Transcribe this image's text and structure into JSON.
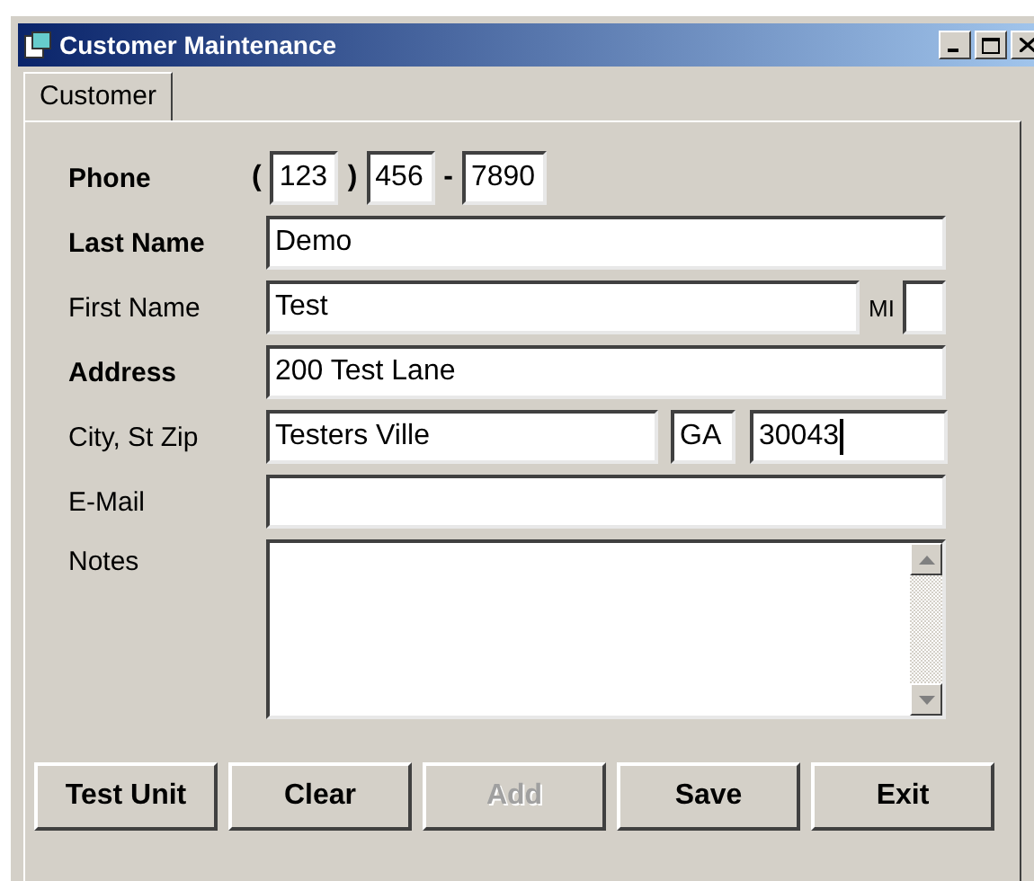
{
  "window": {
    "title": "Customer Maintenance"
  },
  "tabs": [
    {
      "label": "Customer",
      "selected": true
    }
  ],
  "rows": [
    {
      "kind": "phone",
      "label": "Phone",
      "bold": true,
      "segments": [
        {
          "kind": "sep",
          "text": "("
        },
        {
          "kind": "field",
          "value": "123"
        },
        {
          "kind": "sep",
          "text": ")"
        },
        {
          "kind": "field",
          "value": "456"
        },
        {
          "kind": "sep",
          "text": "-"
        },
        {
          "kind": "field",
          "value": "7890"
        }
      ]
    },
    {
      "kind": "text",
      "label": "Last Name",
      "bold": true,
      "value": "Demo"
    },
    {
      "kind": "name_mi",
      "label": "First Name",
      "bold": false,
      "value": "Test",
      "mi_label": "MI"
    },
    {
      "kind": "text",
      "label": "Address",
      "bold": true,
      "value": "200 Test Lane"
    },
    {
      "kind": "city",
      "label": "City, St Zip",
      "bold": false,
      "city": "Testers Ville",
      "state": "GA",
      "zip": "30043",
      "zip_focused": true
    },
    {
      "kind": "text",
      "label": "E-Mail",
      "bold": false
    },
    {
      "kind": "notes",
      "label": "Notes",
      "bold": false
    }
  ],
  "buttons": [
    {
      "label": "Test Unit",
      "disabled": false
    },
    {
      "label": "Clear",
      "disabled": false
    },
    {
      "label": "Add",
      "disabled": true
    },
    {
      "label": "Save",
      "disabled": false
    },
    {
      "label": "Exit",
      "disabled": false
    }
  ]
}
